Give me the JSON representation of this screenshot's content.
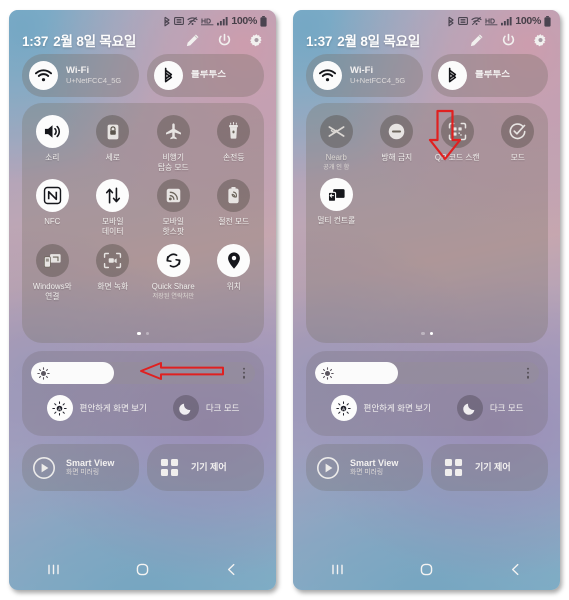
{
  "meta": {
    "device": "Samsung Galaxy Quick Settings panel",
    "accent_red": "#e02020",
    "panel_count": 2
  },
  "statusbar": {
    "icons": [
      "bluetooth-icon",
      "nfc-icon",
      "wifi-off-icon",
      "hd-voice-icon",
      "signal-bars-icon"
    ],
    "battery_percent": "100%",
    "battery_icon": "battery-full-icon"
  },
  "header": {
    "time": "1:37",
    "date": "2월 8일 목요일",
    "icons": [
      {
        "name": "edit-pencil-icon",
        "label": "편집"
      },
      {
        "name": "power-icon",
        "label": "전원"
      },
      {
        "name": "settings-gear-icon",
        "label": "설정"
      }
    ]
  },
  "pills": [
    {
      "name": "wifi-pill",
      "icon": "wifi-icon",
      "title": "Wi-Fi",
      "subtitle": "U+NetFCC4_5G",
      "state": "on"
    },
    {
      "name": "bluetooth-pill",
      "icon": "bluetooth-icon",
      "title": "블루투스",
      "subtitle": "",
      "state": "on"
    }
  ],
  "pages": [
    {
      "index": 0,
      "active_dot": 0,
      "tiles": [
        {
          "name": "tile-sound",
          "icon": "volume-icon",
          "label": "소리",
          "sub": "",
          "state": "on"
        },
        {
          "name": "tile-rotation",
          "icon": "rotation-lock-icon",
          "label": "세로",
          "sub": "",
          "state": "off"
        },
        {
          "name": "tile-airplane",
          "icon": "airplane-icon",
          "label": "비행기\n탑승 모드",
          "sub": "",
          "state": "off"
        },
        {
          "name": "tile-flashlight",
          "icon": "flashlight-icon",
          "label": "손전등",
          "sub": "",
          "state": "off"
        },
        {
          "name": "tile-nfc",
          "icon": "nfc-icon",
          "label": "NFC",
          "sub": "",
          "state": "on"
        },
        {
          "name": "tile-mobile-data",
          "icon": "mobile-data-icon",
          "label": "모바일\n데이터",
          "sub": "",
          "state": "on"
        },
        {
          "name": "tile-hotspot",
          "icon": "hotspot-icon",
          "label": "모바일\n핫스팟",
          "sub": "",
          "state": "off"
        },
        {
          "name": "tile-power-saving",
          "icon": "power-saving-icon",
          "label": "절전 모드",
          "sub": "",
          "state": "off"
        },
        {
          "name": "tile-link-to-windows",
          "icon": "link-to-windows-icon",
          "label": "Windows와\n연결",
          "sub": "",
          "state": "off"
        },
        {
          "name": "tile-screen-recorder",
          "icon": "screen-record-icon",
          "label": "화면 녹화",
          "sub": "",
          "state": "off"
        },
        {
          "name": "tile-quick-share",
          "icon": "quick-share-icon",
          "label": "Quick Share",
          "sub": "저장된 연락처만",
          "state": "on"
        },
        {
          "name": "tile-location",
          "icon": "location-pin-icon",
          "label": "위치",
          "sub": "",
          "state": "on"
        }
      ]
    },
    {
      "index": 1,
      "active_dot": 1,
      "tiles": [
        {
          "name": "tile-nearby-share",
          "icon": "nearby-share-icon",
          "label": "Nearb",
          "sub": "공개 인 함",
          "state": "off"
        },
        {
          "name": "tile-do-not-disturb",
          "icon": "do-not-disturb-icon",
          "label": "방해 금지",
          "sub": "",
          "state": "off"
        },
        {
          "name": "tile-qr-scan",
          "icon": "qr-scan-icon",
          "label": "QR 코드 스캔",
          "sub": "",
          "state": "off"
        },
        {
          "name": "tile-modes",
          "icon": "modes-icon",
          "label": "모드",
          "sub": "",
          "state": "off"
        },
        {
          "name": "tile-multi-control",
          "icon": "multi-control-icon",
          "label": "멀티 컨트롤",
          "sub": "",
          "state": "on"
        }
      ]
    }
  ],
  "brightness": {
    "name": "brightness-slider",
    "icon": "brightness-sun-icon",
    "fill_percent": 37,
    "menu_icon": "overflow-menu-icon",
    "actions": [
      {
        "name": "eye-comfort-shield-toggle",
        "icon": "eye-comfort-icon",
        "label": "편안하게 화면 보기",
        "state": "on"
      },
      {
        "name": "dark-mode-toggle",
        "icon": "moon-icon",
        "label": "다크 모드",
        "state": "off"
      }
    ]
  },
  "bottom_tiles": [
    {
      "name": "smart-view-button",
      "icon": "smart-view-icon",
      "title": "Smart View",
      "subtitle": "화면 미러링"
    },
    {
      "name": "device-control-button",
      "icon": "device-control-icon",
      "title": "기기 제어",
      "subtitle": ""
    }
  ],
  "navbar": [
    {
      "name": "nav-recents-button",
      "icon": "recents-icon"
    },
    {
      "name": "nav-home-button",
      "icon": "home-circle-icon"
    },
    {
      "name": "nav-back-button",
      "icon": "back-chevron-icon"
    }
  ],
  "annotations": [
    {
      "name": "annotation-arrow-left",
      "direction": "left",
      "points_at": "page-dots",
      "color": "#e02020",
      "panel": 0
    },
    {
      "name": "annotation-arrow-down",
      "direction": "down",
      "points_at": "tile-qr-scan",
      "color": "#e02020",
      "panel": 1
    }
  ]
}
